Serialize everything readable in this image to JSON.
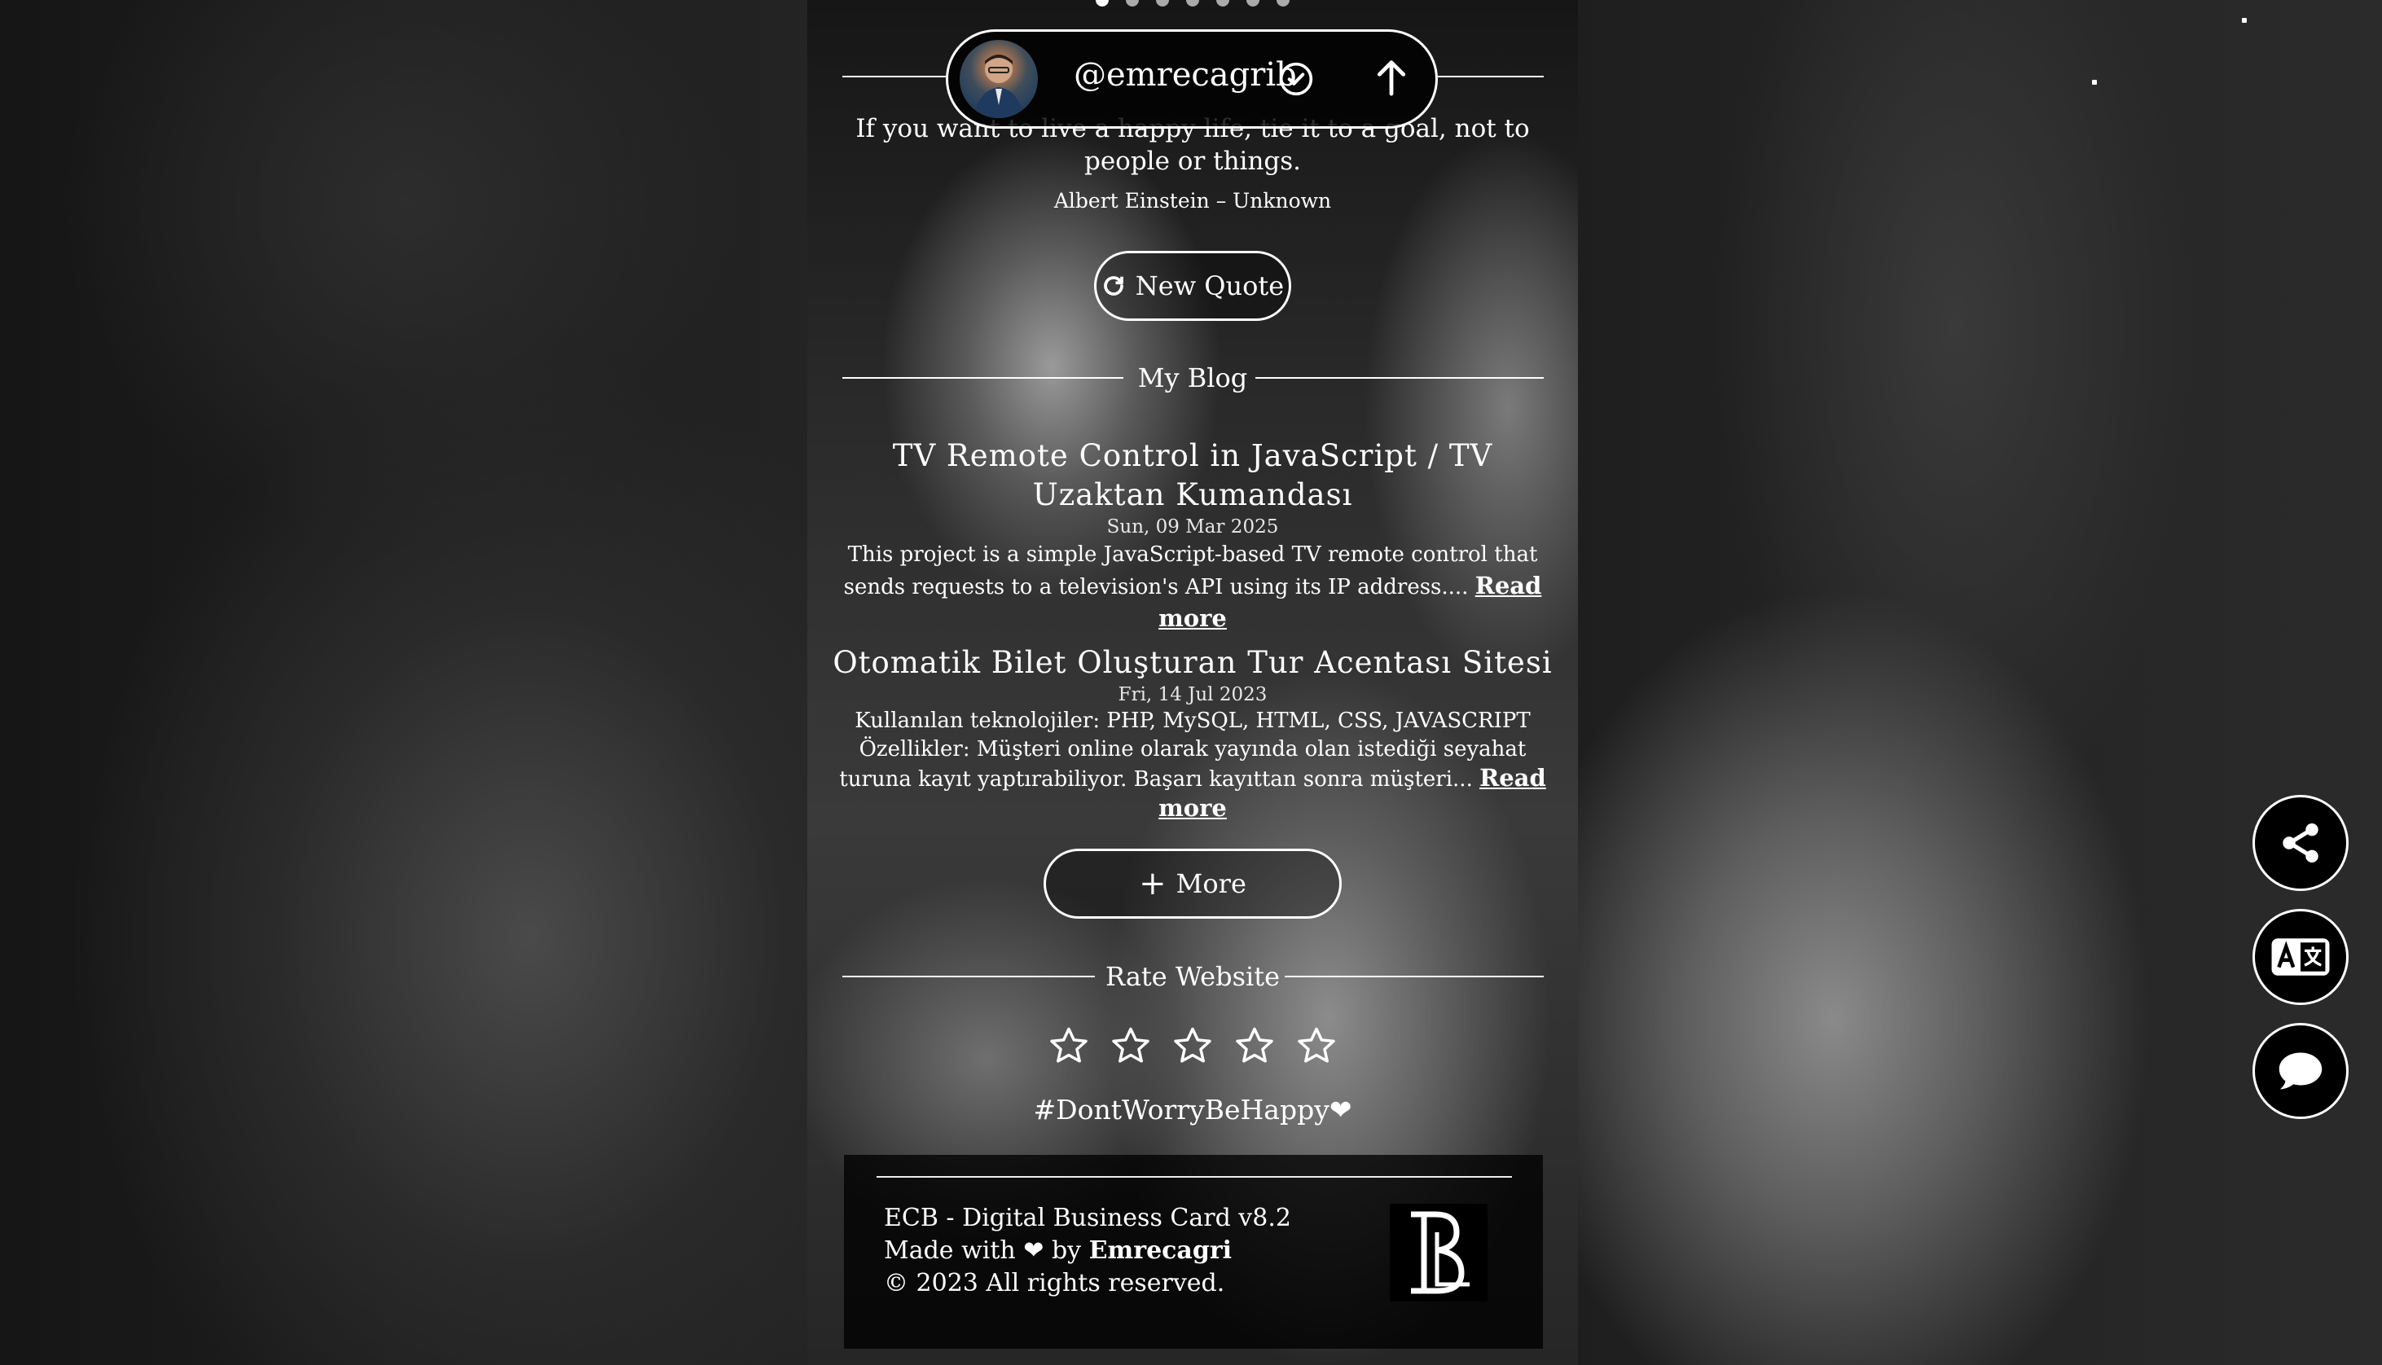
{
  "header": {
    "username": "@emrecagrib",
    "avatar_alt": "profile photo"
  },
  "slider": {
    "dots": 7,
    "active_index": 0
  },
  "quote": {
    "text": "If you want to live a happy life, tie it to a goal, not to people or things.",
    "author": "Albert Einstein",
    "source": "Unknown",
    "separator": "–",
    "new_quote_label": "New Quote"
  },
  "blog": {
    "section_title": "My Blog",
    "posts": [
      {
        "title": "TV Remote Control in JavaScript / TV Uzaktan Kumandası",
        "date": "Sun, 09 Mar 2025",
        "excerpt": "This project is a simple JavaScript-based TV remote control that sends requests to a television's API using its IP address....",
        "read_more": "Read more"
      },
      {
        "title": "Otomatik Bilet Oluşturan Tur Acentası Sitesi",
        "date": "Fri, 14 Jul 2023",
        "excerpt_line1": "Kullanılan teknolojiler: PHP, MySQL, HTML, CSS, JAVASCRIPT",
        "excerpt_line2": "Özellikler: Müşteri online olarak yayında olan istediği seyahat turuna kayıt yaptırabiliyor. Başarı kayıttan sonra müşteri...",
        "read_more": "Read more"
      }
    ],
    "more_label": "More"
  },
  "rating": {
    "section_title": "Rate Website",
    "max_stars": 5,
    "current": 0
  },
  "hashtag": "#DontWorryBeHappy❤",
  "footer": {
    "line1": "ECB - Digital Business Card v8.2",
    "made_with": "Made with ❤ by",
    "author": "Emrecagri",
    "copyright": "© 2023 All rights reserved."
  },
  "fab": {
    "share_icon": "share-icon",
    "translate_icon": "translate-icon",
    "chat_icon": "chat-icon"
  },
  "colors": {
    "accent": "#ffffff",
    "panel": "#000000"
  }
}
